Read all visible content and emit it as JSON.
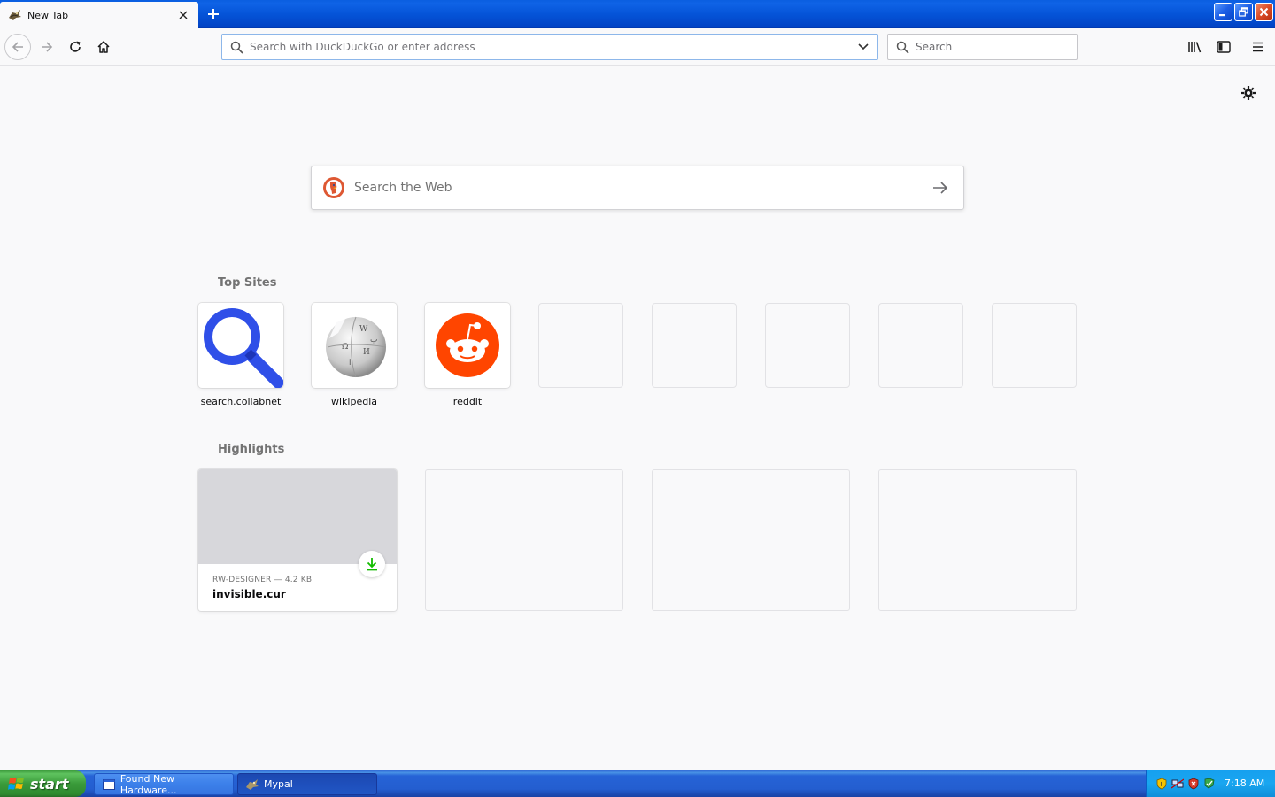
{
  "browser": {
    "tab": {
      "title": "New Tab",
      "icon": "mypal-favicon"
    },
    "url_placeholder": "Search with DuckDuckGo or enter address",
    "search_placeholder": "Search"
  },
  "newtab": {
    "web_search_placeholder": "Search the Web",
    "top_sites_title": "Top Sites",
    "top_sites": [
      {
        "label": "search.collabnet",
        "icon": "magnifier-logo"
      },
      {
        "label": "wikipedia",
        "icon": "wikipedia-globe-logo"
      },
      {
        "label": "reddit",
        "icon": "reddit-snoo-logo"
      }
    ],
    "highlights_title": "Highlights",
    "highlights": [
      {
        "meta": "RW-DESIGNER — 4.2 KB",
        "title": "invisible.cur",
        "icon": "download-icon"
      }
    ],
    "colors": {
      "reddit": "#ff4500",
      "collabnet": "#2f4fe8",
      "download": "#12bc00"
    }
  },
  "taskbar": {
    "start_label": "start",
    "tasks": [
      {
        "label": "Found New Hardware...",
        "icon": "window-icon"
      },
      {
        "label": "Mypal",
        "icon": "mypal-icon"
      }
    ],
    "clock": "7:18 AM"
  }
}
